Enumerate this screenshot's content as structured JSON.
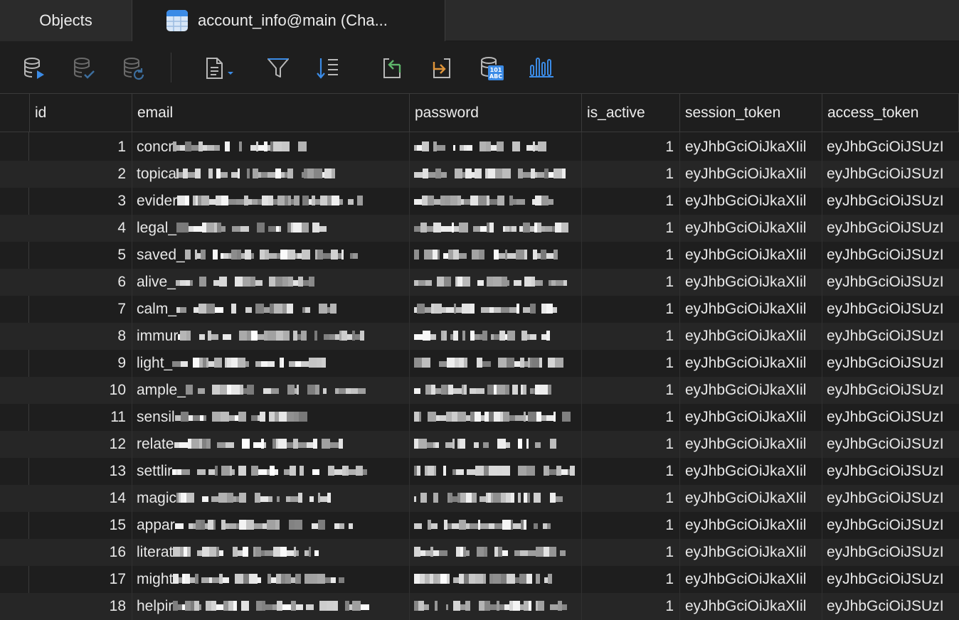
{
  "tabs": {
    "objects_label": "Objects",
    "active_label": "account_info@main (Cha..."
  },
  "toolbar": {
    "buttons": [
      {
        "icon": "database-run-icon"
      },
      {
        "icon": "database-check-icon"
      },
      {
        "icon": "database-refresh-icon"
      },
      {
        "icon": "document-dropdown-icon"
      },
      {
        "icon": "filter-icon"
      },
      {
        "icon": "sort-icon"
      },
      {
        "icon": "import-icon"
      },
      {
        "icon": "export-icon"
      },
      {
        "icon": "data-type-icon"
      },
      {
        "icon": "chart-icon"
      }
    ]
  },
  "grid": {
    "columns": [
      "id",
      "email",
      "password",
      "is_active",
      "session_token",
      "access_token"
    ],
    "rows": [
      {
        "id": "1",
        "email": "concr",
        "is_active": "1",
        "session_token": "eyJhbGciOiJkaXIil",
        "access_token": "eyJhbGciOiJSUzI"
      },
      {
        "id": "2",
        "email": "topica",
        "is_active": "1",
        "session_token": "eyJhbGciOiJkaXIil",
        "access_token": "eyJhbGciOiJSUzI"
      },
      {
        "id": "3",
        "email": "evider",
        "is_active": "1",
        "session_token": "eyJhbGciOiJkaXIil",
        "access_token": "eyJhbGciOiJSUzI"
      },
      {
        "id": "4",
        "email": "legal_",
        "is_active": "1",
        "session_token": "eyJhbGciOiJkaXIil",
        "access_token": "eyJhbGciOiJSUzI"
      },
      {
        "id": "5",
        "email": "saved_",
        "is_active": "1",
        "session_token": "eyJhbGciOiJkaXIil",
        "access_token": "eyJhbGciOiJSUzI"
      },
      {
        "id": "6",
        "email": "alive_",
        "is_active": "1",
        "session_token": "eyJhbGciOiJkaXIil",
        "access_token": "eyJhbGciOiJSUzI"
      },
      {
        "id": "7",
        "email": "calm_",
        "is_active": "1",
        "session_token": "eyJhbGciOiJkaXIil",
        "access_token": "eyJhbGciOiJSUzI"
      },
      {
        "id": "8",
        "email": "immur",
        "is_active": "1",
        "session_token": "eyJhbGciOiJkaXIil",
        "access_token": "eyJhbGciOiJSUzI"
      },
      {
        "id": "9",
        "email": "light_",
        "is_active": "1",
        "session_token": "eyJhbGciOiJkaXIil",
        "access_token": "eyJhbGciOiJSUzI"
      },
      {
        "id": "10",
        "email": "ample_",
        "is_active": "1",
        "session_token": "eyJhbGciOiJkaXIil",
        "access_token": "eyJhbGciOiJSUzI"
      },
      {
        "id": "11",
        "email": "sensil",
        "is_active": "1",
        "session_token": "eyJhbGciOiJkaXIil",
        "access_token": "eyJhbGciOiJSUzI"
      },
      {
        "id": "12",
        "email": "relate",
        "is_active": "1",
        "session_token": "eyJhbGciOiJkaXIil",
        "access_token": "eyJhbGciOiJSUzI"
      },
      {
        "id": "13",
        "email": "settlir",
        "is_active": "1",
        "session_token": "eyJhbGciOiJkaXIil",
        "access_token": "eyJhbGciOiJSUzI"
      },
      {
        "id": "14",
        "email": "magic",
        "is_active": "1",
        "session_token": "eyJhbGciOiJkaXIil",
        "access_token": "eyJhbGciOiJSUzI"
      },
      {
        "id": "15",
        "email": "appar",
        "is_active": "1",
        "session_token": "eyJhbGciOiJkaXIil",
        "access_token": "eyJhbGciOiJSUzI"
      },
      {
        "id": "16",
        "email": "literat",
        "is_active": "1",
        "session_token": "eyJhbGciOiJkaXIil",
        "access_token": "eyJhbGciOiJSUzI"
      },
      {
        "id": "17",
        "email": "might",
        "is_active": "1",
        "session_token": "eyJhbGciOiJkaXIil",
        "access_token": "eyJhbGciOiJSUzI"
      },
      {
        "id": "18",
        "email": "helpir",
        "is_active": "1",
        "session_token": "eyJhbGciOiJkaXIil",
        "access_token": "eyJhbGciOiJSUzI"
      }
    ]
  },
  "colors": {
    "accent_blue": "#3b8be6",
    "toolbar_icon_gray": "#9a9a9a",
    "import_green": "#5fb66a",
    "export_orange": "#e0953a"
  }
}
